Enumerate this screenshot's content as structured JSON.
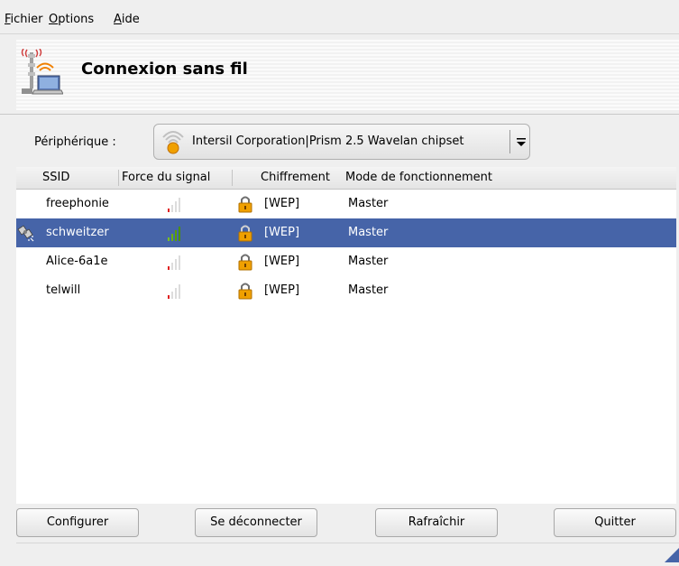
{
  "menu": {
    "items": [
      {
        "mnemonic": "F",
        "rest": "ichier"
      },
      {
        "mnemonic": "O",
        "rest": "ptions"
      },
      {
        "mnemonic": "A",
        "rest": "ide"
      }
    ]
  },
  "banner": {
    "title": "Connexion sans fil",
    "icon": "wireless-laptop-icon"
  },
  "device": {
    "label": "Périphérique :",
    "selected": "Intersil Corporation|Prism 2.5 Wavelan chipset",
    "icon": "wifi-signal-icon"
  },
  "table": {
    "columns": [
      "SSID",
      "Force du signal",
      "Chiffrement",
      "Mode de fonctionnement"
    ],
    "rows": [
      {
        "ssid": "freephonie",
        "signal_bars": 1,
        "encryption": "[WEP]",
        "mode": "Master",
        "selected": false
      },
      {
        "ssid": "schweitzer",
        "signal_bars": 4,
        "encryption": "[WEP]",
        "mode": "Master",
        "selected": true,
        "connected": true
      },
      {
        "ssid": "Alice-6a1e",
        "signal_bars": 1,
        "encryption": "[WEP]",
        "mode": "Master",
        "selected": false
      },
      {
        "ssid": "telwill",
        "signal_bars": 1,
        "encryption": "[WEP]",
        "mode": "Master",
        "selected": false
      }
    ]
  },
  "buttons": {
    "configure": "Configurer",
    "disconnect": "Se déconnecter",
    "refresh": "Rafraîchir",
    "quit": "Quitter"
  },
  "colors": {
    "selection": "#4664a8",
    "signal_low": "#e02020",
    "signal_good": "#5aa000",
    "lock_body": "#f0a000"
  }
}
